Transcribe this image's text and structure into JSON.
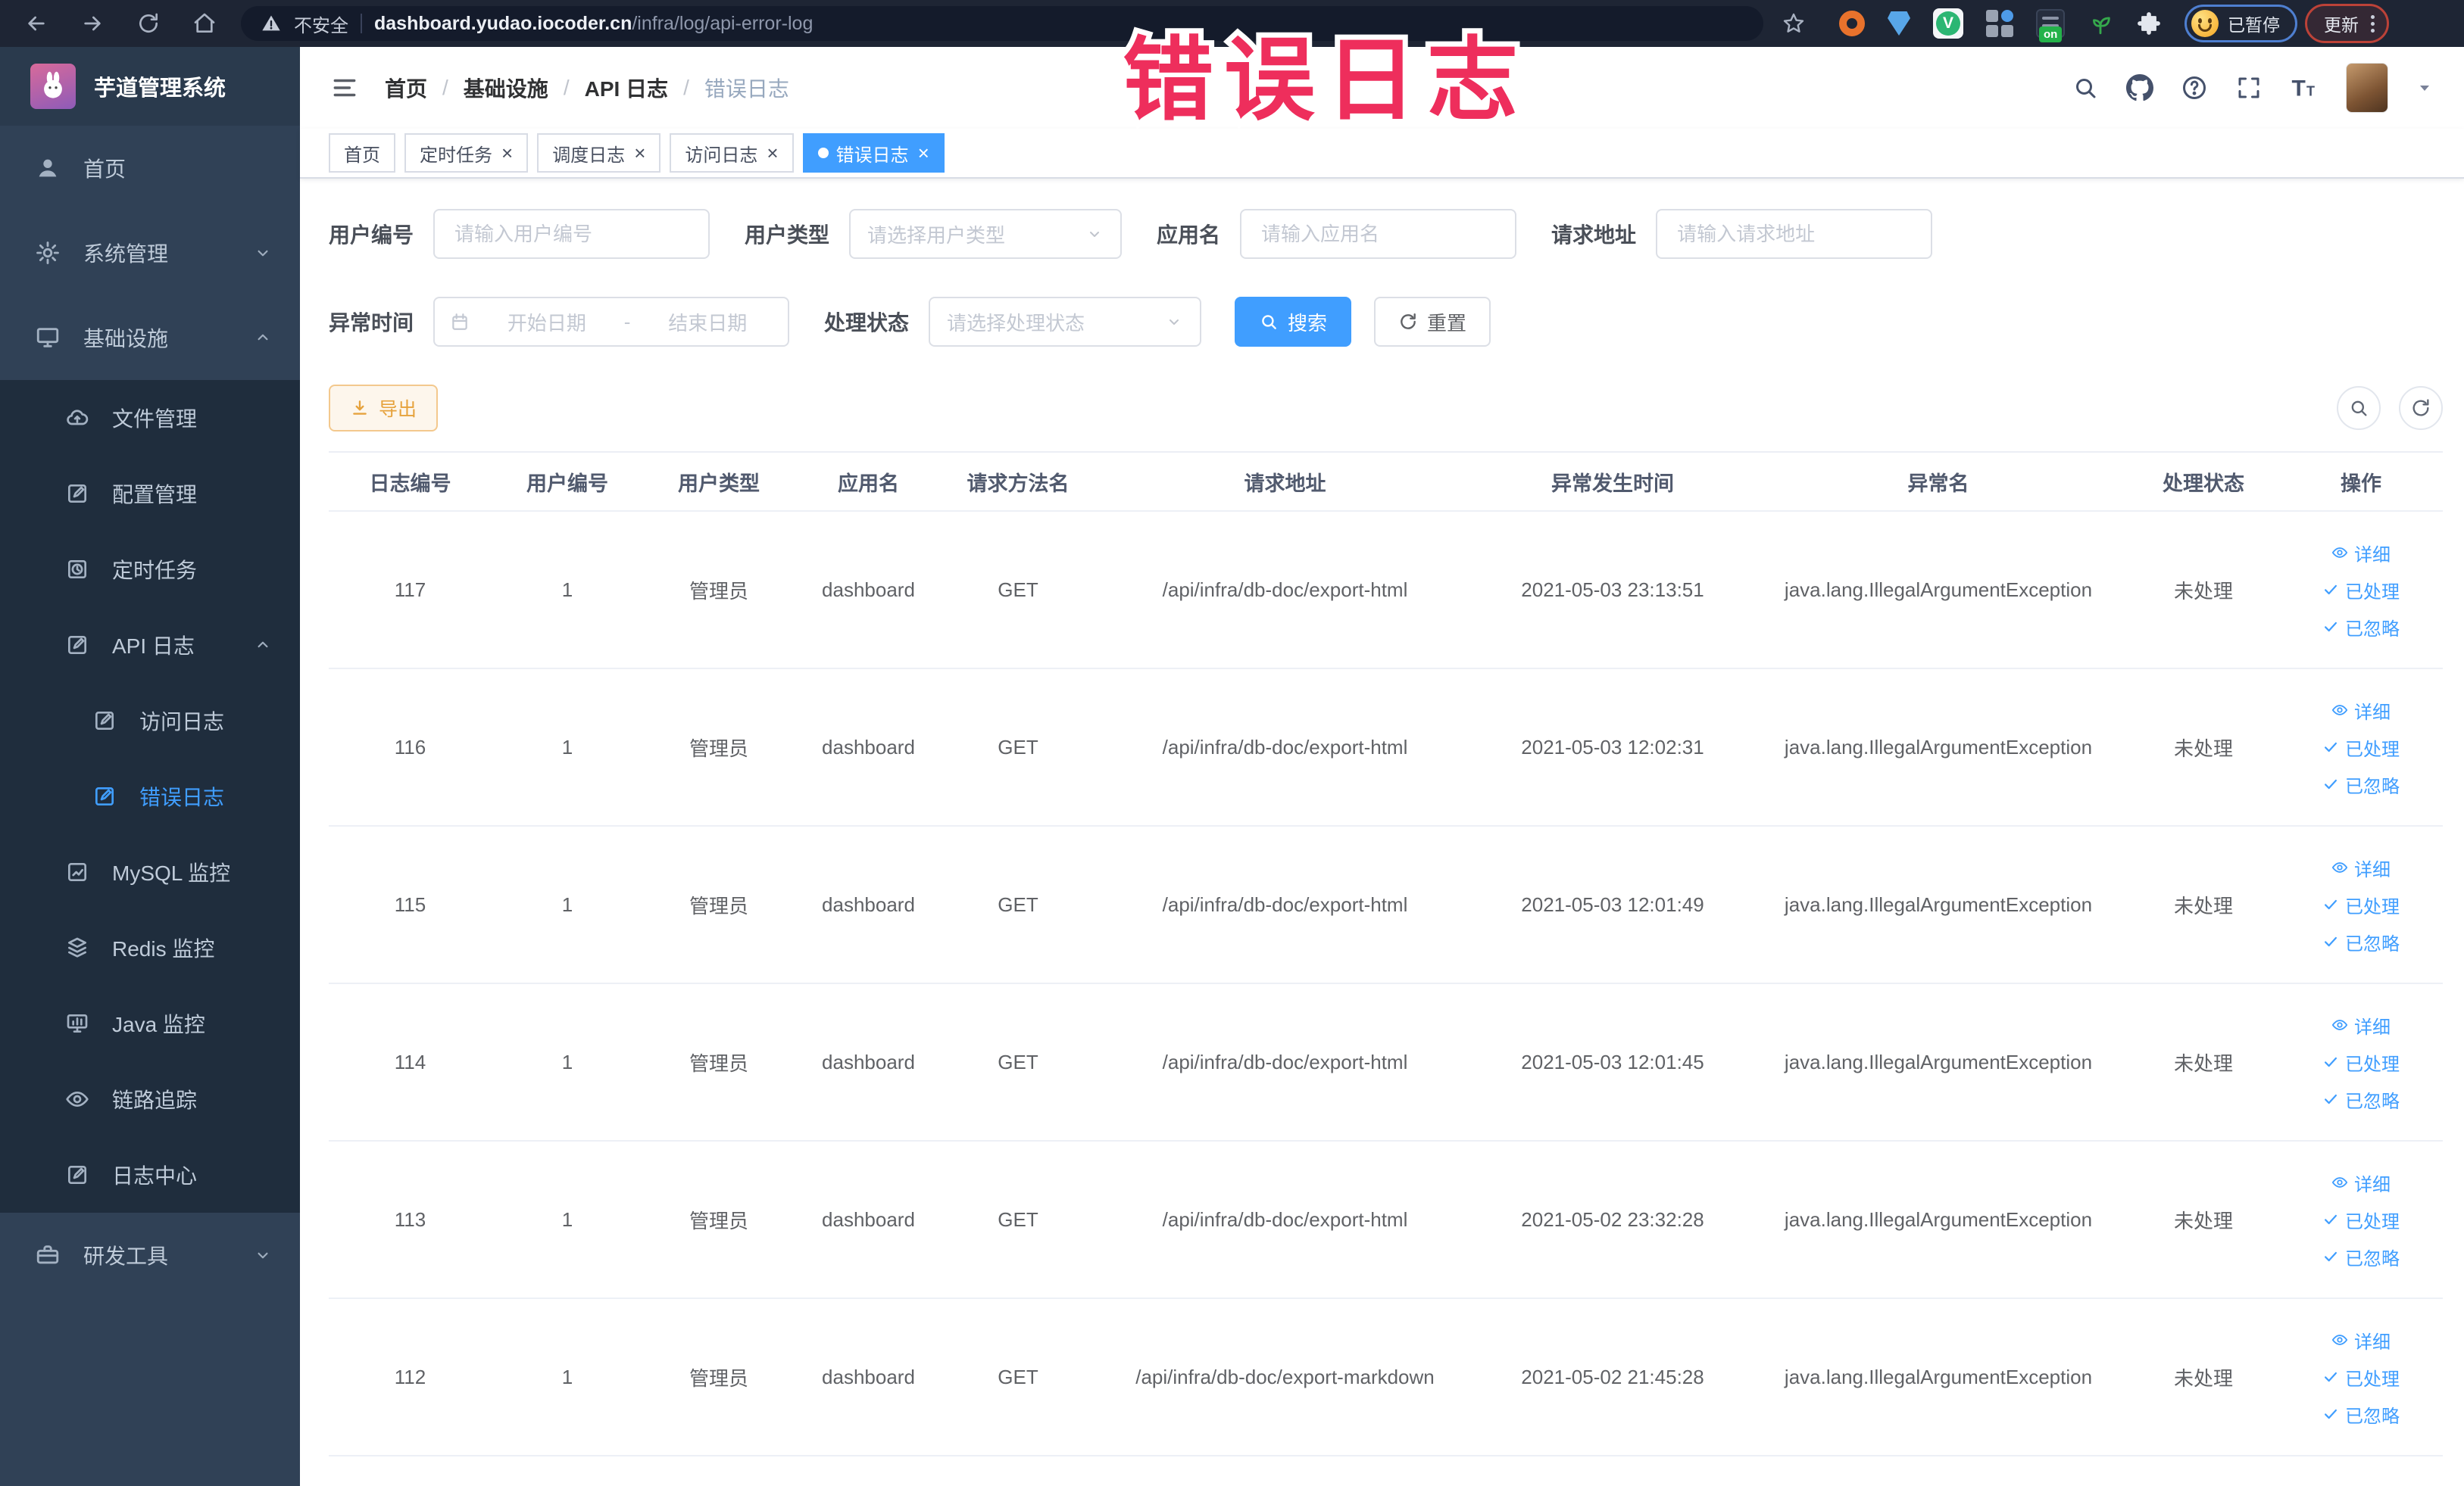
{
  "ui": {
    "close_glyph": "×"
  },
  "annotation": {
    "text": "错误日志"
  },
  "browser": {
    "security_label": "不安全",
    "url_domain": "dashboard.yudao.iocoder.cn",
    "url_path": "/infra/log/api-error-log",
    "extension_badge": "on",
    "profile_chip_label": "已暂停",
    "update_button_label": "更新"
  },
  "sidebar": {
    "title": "芋道管理系统",
    "items": {
      "home": "首页",
      "system": "系统管理",
      "infra": "基础设施",
      "file": "文件管理",
      "config": "配置管理",
      "job": "定时任务",
      "api_log": "API 日志",
      "access_log": "访问日志",
      "error_log": "错误日志",
      "mysql": "MySQL 监控",
      "redis": "Redis 监控",
      "java": "Java 监控",
      "trace": "链路追踪",
      "log_center": "日志中心",
      "dev_tools": "研发工具"
    }
  },
  "header": {
    "breadcrumb": [
      {
        "label": "首页",
        "sep": true,
        "current": false
      },
      {
        "label": "基础设施",
        "sep": true,
        "current": false
      },
      {
        "label": "API 日志",
        "sep": true,
        "current": false
      },
      {
        "label": "错误日志",
        "sep": false,
        "current": true
      }
    ]
  },
  "tabs": [
    {
      "label": "首页",
      "closable": false,
      "active": false
    },
    {
      "label": "定时任务",
      "closable": true,
      "active": false
    },
    {
      "label": "调度日志",
      "closable": true,
      "active": false
    },
    {
      "label": "访问日志",
      "closable": true,
      "active": false
    },
    {
      "label": "错误日志",
      "closable": true,
      "active": true
    }
  ],
  "filters": {
    "user_id": {
      "label": "用户编号",
      "placeholder": "请输入用户编号"
    },
    "user_type": {
      "label": "用户类型",
      "placeholder": "请选择用户类型"
    },
    "app_name": {
      "label": "应用名",
      "placeholder": "请输入应用名"
    },
    "request_url": {
      "label": "请求地址",
      "placeholder": "请输入请求地址"
    },
    "exception_time": {
      "label": "异常时间",
      "start_placeholder": "开始日期",
      "separator": "-",
      "end_placeholder": "结束日期"
    },
    "process_status": {
      "label": "处理状态",
      "placeholder": "请选择处理状态"
    },
    "search_button": "搜索",
    "reset_button": "重置"
  },
  "toolbar": {
    "export_button": "导出"
  },
  "table": {
    "columns": [
      "日志编号",
      "用户编号",
      "用户类型",
      "应用名",
      "请求方法名",
      "请求地址",
      "异常发生时间",
      "异常名",
      "处理状态",
      "操作"
    ],
    "actions": {
      "detail": "详细",
      "processed": "已处理",
      "ignored": "已忽略"
    },
    "rows": [
      {
        "id": "117",
        "user_id": "1",
        "user_type": "管理员",
        "app": "dashboard",
        "method": "GET",
        "url": "/api/infra/db-doc/export-html",
        "time": "2021-05-03 23:13:51",
        "exception": "java.lang.IllegalArgumentException",
        "status": "未处理"
      },
      {
        "id": "116",
        "user_id": "1",
        "user_type": "管理员",
        "app": "dashboard",
        "method": "GET",
        "url": "/api/infra/db-doc/export-html",
        "time": "2021-05-03 12:02:31",
        "exception": "java.lang.IllegalArgumentException",
        "status": "未处理"
      },
      {
        "id": "115",
        "user_id": "1",
        "user_type": "管理员",
        "app": "dashboard",
        "method": "GET",
        "url": "/api/infra/db-doc/export-html",
        "time": "2021-05-03 12:01:49",
        "exception": "java.lang.IllegalArgumentException",
        "status": "未处理"
      },
      {
        "id": "114",
        "user_id": "1",
        "user_type": "管理员",
        "app": "dashboard",
        "method": "GET",
        "url": "/api/infra/db-doc/export-html",
        "time": "2021-05-03 12:01:45",
        "exception": "java.lang.IllegalArgumentException",
        "status": "未处理"
      },
      {
        "id": "113",
        "user_id": "1",
        "user_type": "管理员",
        "app": "dashboard",
        "method": "GET",
        "url": "/api/infra/db-doc/export-html",
        "time": "2021-05-02 23:32:28",
        "exception": "java.lang.IllegalArgumentException",
        "status": "未处理"
      },
      {
        "id": "112",
        "user_id": "1",
        "user_type": "管理员",
        "app": "dashboard",
        "method": "GET",
        "url": "/api/infra/db-doc/export-markdown",
        "time": "2021-05-02 21:45:28",
        "exception": "java.lang.IllegalArgumentException",
        "status": "未处理"
      }
    ]
  }
}
